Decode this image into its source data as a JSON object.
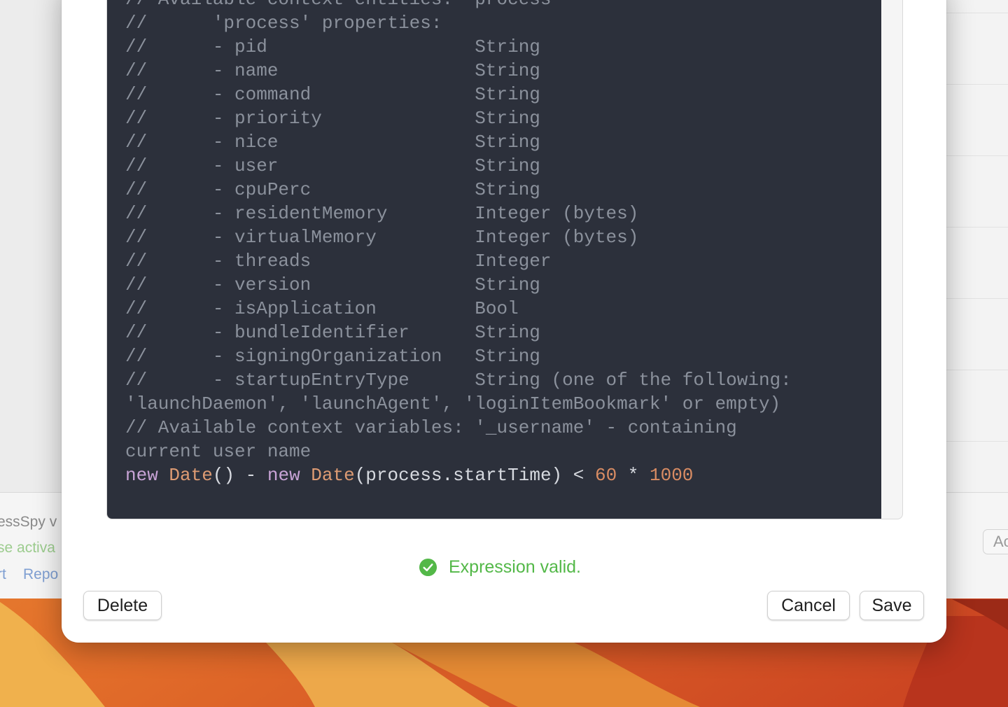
{
  "background_app": {
    "version_text": "essSpy v",
    "license_text": "se activa",
    "link_left": "rt",
    "link_report": "Repo",
    "add_button_label": "Ac"
  },
  "editor": {
    "lines": [
      [
        {
          "t": "// Available context entities:  process",
          "c": "cm"
        }
      ],
      [
        {
          "t": "//      'process' properties:",
          "c": "cm"
        }
      ],
      [
        {
          "t": "//      - pid                   String",
          "c": "cm"
        }
      ],
      [
        {
          "t": "//      - name                  String",
          "c": "cm"
        }
      ],
      [
        {
          "t": "//      - command               String",
          "c": "cm"
        }
      ],
      [
        {
          "t": "//      - priority              String",
          "c": "cm"
        }
      ],
      [
        {
          "t": "//      - nice                  String",
          "c": "cm"
        }
      ],
      [
        {
          "t": "//      - user                  String",
          "c": "cm"
        }
      ],
      [
        {
          "t": "//      - cpuPerc               String",
          "c": "cm"
        }
      ],
      [
        {
          "t": "//      - residentMemory        Integer (bytes)",
          "c": "cm"
        }
      ],
      [
        {
          "t": "//      - virtualMemory         Integer (bytes)",
          "c": "cm"
        }
      ],
      [
        {
          "t": "//      - threads               Integer",
          "c": "cm"
        }
      ],
      [
        {
          "t": "//      - version               String",
          "c": "cm"
        }
      ],
      [
        {
          "t": "//      - isApplication         Bool",
          "c": "cm"
        }
      ],
      [
        {
          "t": "//      - bundleIdentifier      String",
          "c": "cm"
        }
      ],
      [
        {
          "t": "//      - signingOrganization   String",
          "c": "cm"
        }
      ],
      [
        {
          "t": "//      - startupEntryType      String (one of the following:",
          "c": "cm"
        }
      ],
      [
        {
          "t": "'launchDaemon', 'launchAgent', 'loginItemBookmark' or empty)",
          "c": "cm"
        }
      ],
      [
        {
          "t": "// Available context variables: '_username' - containing",
          "c": "cm"
        }
      ],
      [
        {
          "t": "current user name",
          "c": "cm"
        }
      ],
      [
        {
          "t": "new",
          "c": "kw"
        },
        {
          "t": " ",
          "c": "op"
        },
        {
          "t": "Date",
          "c": "fn"
        },
        {
          "t": "() - ",
          "c": "op"
        },
        {
          "t": "new",
          "c": "kw"
        },
        {
          "t": " ",
          "c": "op"
        },
        {
          "t": "Date",
          "c": "fn"
        },
        {
          "t": "(process.startTime) < ",
          "c": "op"
        },
        {
          "t": "60",
          "c": "num"
        },
        {
          "t": " * ",
          "c": "op"
        },
        {
          "t": "1000",
          "c": "num"
        }
      ]
    ]
  },
  "status": {
    "icon": "checkmark-circle-icon",
    "text": "Expression valid.",
    "color": "#53b848"
  },
  "buttons": {
    "delete": "Delete",
    "cancel": "Cancel",
    "save": "Save"
  },
  "colors": {
    "editor_background": "#2c303b",
    "comment": "#8b919c",
    "keyword": "#c8a3d6",
    "function": "#dd9b73",
    "number": "#d98c63"
  }
}
